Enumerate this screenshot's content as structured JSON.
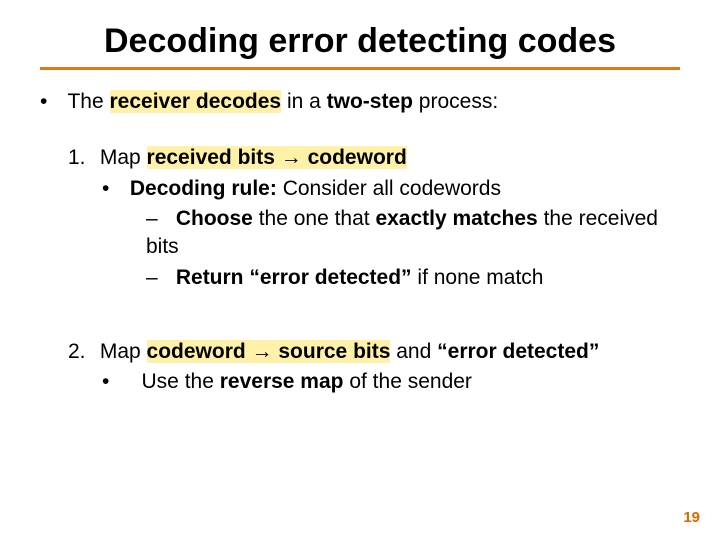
{
  "title": "Decoding error detecting codes",
  "line1_pre": "The ",
  "line1_hl": "receiver decodes",
  "line1_post": " in a ",
  "line1_b2": "two-step",
  "line1_tail": " process:",
  "step1_num": "1.",
  "step1_pre": "Map ",
  "step1_hl": "received bits → codeword",
  "step1b_bul": "•",
  "step1b_b": "Decoding rule:",
  "step1b_rest": " Consider all codewords",
  "step1c_dash": "–",
  "step1c_b1": "Choose ",
  "step1c_mid": "the one that ",
  "step1c_b2": "exactly matches ",
  "step1c_tail": "the received bits",
  "step1d_dash": "–",
  "step1d_b": "Return “error detected”",
  "step1d_tail": " if none match",
  "step2_num": "2.",
  "step2_pre": "Map ",
  "step2_hl": "codeword → source bits",
  "step2_mid": " and ",
  "step2_b2": "“error detected”",
  "step2b_bul": "•",
  "step2b_pre": "Use the ",
  "step2b_b": "reverse map",
  "step2b_tail": " of the sender",
  "page_number": "19",
  "bullet": "•"
}
